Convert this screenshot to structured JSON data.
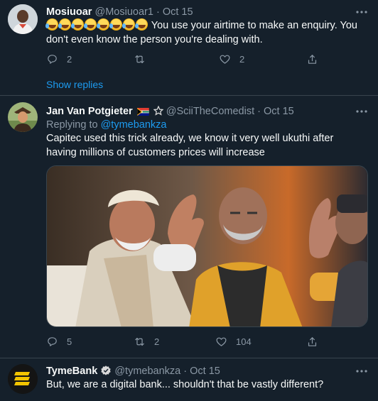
{
  "tweets": [
    {
      "display_name": "Mosiuoar",
      "handle": "@Mosiuoar1",
      "separator": "·",
      "date": "Oct 15",
      "emoji_count": 8,
      "text": "You use your airtime to make an enquiry. You don't even know the person you're dealing with.",
      "reply_count": "2",
      "retweet_count": "",
      "like_count": "2",
      "show_replies": "Show replies"
    },
    {
      "display_name": "Jan Van Potgieter",
      "handle": "@SciiTheComedist",
      "separator": "·",
      "date": "Oct 15",
      "replying_prefix": "Replying to ",
      "replying_to": "@tymebankza",
      "text": "Capitec used this trick already, we know it very well ukuthi after having millions of customers prices will increase",
      "reply_count": "5",
      "retweet_count": "2",
      "like_count": "104"
    },
    {
      "display_name": "TymeBank",
      "handle": "@tymebankza",
      "separator": "·",
      "date": "Oct 15",
      "text": "But, we are a digital bank... shouldn't that be vastly different?"
    }
  ],
  "colors": {
    "background": "#15202b",
    "divider": "#38444d",
    "muted_text": "#8b98a5",
    "link": "#1d9bf0",
    "verified": "#1d9bf0"
  },
  "icons": [
    "more-icon",
    "reply-icon",
    "retweet-icon",
    "like-icon",
    "share-icon",
    "verified-icon",
    "south-africa-flag-icon",
    "star-icon"
  ]
}
